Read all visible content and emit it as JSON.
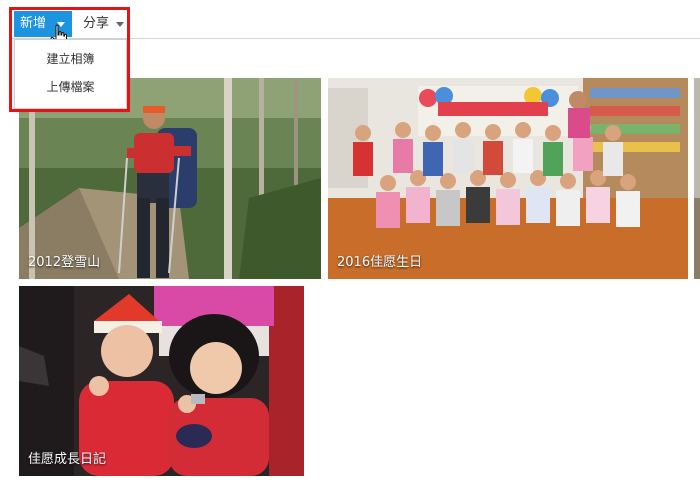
{
  "toolbar": {
    "new_label": "新增",
    "share_label": "分享"
  },
  "new_menu": {
    "items": [
      {
        "label": "建立相簿"
      },
      {
        "label": "上傳檔案"
      }
    ]
  },
  "albums": [
    {
      "title": "2012登雪山",
      "icon": "photo-hiker"
    },
    {
      "title": "2016佳愿生日",
      "icon": "photo-classroom-group"
    },
    {
      "title": "佳愿成長日記",
      "icon": "photo-two-girls"
    }
  ],
  "colors": {
    "accent": "#1d94df",
    "highlight": "#e01515"
  }
}
